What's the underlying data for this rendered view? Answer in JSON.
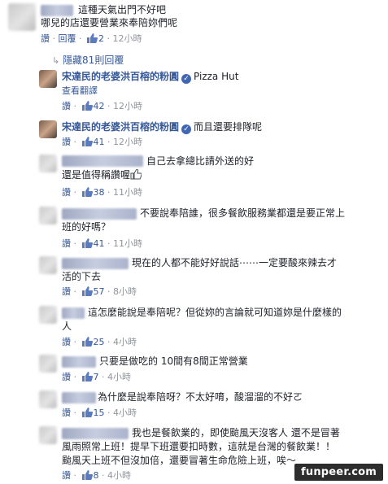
{
  "comments": [
    {
      "text_lines": [
        "這種天氣出門不好吧",
        "哪兒的店還要營業來奉陪妳們呢"
      ],
      "read_label": "讚",
      "reply_label": "回覆",
      "likes": "2",
      "time": "12小時"
    }
  ],
  "hidden_replies_label": "隱藏81則回覆",
  "replies": [
    {
      "author": "宋達民的老婆洪百榕的粉圓",
      "text": "Pizza Hut",
      "translate_label": "查看翻譯",
      "read_label": "讚",
      "likes": "42",
      "time": "12小時"
    },
    {
      "author": "宋達民的老婆洪百榕的粉圓",
      "text": "而且還要排隊呢",
      "read_label": "讚",
      "likes": "41",
      "time": "12小時"
    },
    {
      "text_lines": [
        "自己去拿總比請外送的好",
        "還是值得稱讚喔"
      ],
      "read_label": "讚",
      "likes": "38",
      "time": "11小時"
    },
    {
      "text_lines": [
        "不要說奉陪誰，很多餐飲服務業都還是要正常上",
        "班的好嗎？"
      ],
      "read_label": "讚",
      "likes": "41",
      "time": "11小時"
    },
    {
      "text_lines": [
        "現在的人都不能好好說話⋯⋯一定要酸來辣去才",
        "活的下去"
      ],
      "read_label": "讚",
      "likes": "57",
      "time": "8小時"
    },
    {
      "text_lines": [
        "這怎麼能說是奉陪呢？但從妳的言論就可知道妳是什麼樣的",
        "人"
      ],
      "read_label": "讚",
      "likes": "25",
      "time": "4小時"
    },
    {
      "text_lines": [
        "只要是做吃的 10間有8間正常營業"
      ],
      "read_label": "讚",
      "likes": "7",
      "time": "4小時"
    },
    {
      "text_lines": [
        "為什麼是說奉陪呀？不太好唷，酸溜溜的不好ㄛ"
      ],
      "read_label": "讚",
      "likes": "15",
      "time": "4小時"
    },
    {
      "text_lines": [
        "我也是餐飲業的，即使颱風天沒客人 還不是冒著",
        "風雨照常上班！提早下班還要扣時數，這就是台灣的餐飲業！！",
        "颱風天上班不但沒加倍，還要冒著生命危險上班，唉～"
      ],
      "read_label": "讚",
      "likes": "8",
      "time": "4小時"
    }
  ],
  "watermark": "funpeer.com",
  "colors": {
    "link": "#365899",
    "meta": "#90949c",
    "text": "#1d2129"
  }
}
